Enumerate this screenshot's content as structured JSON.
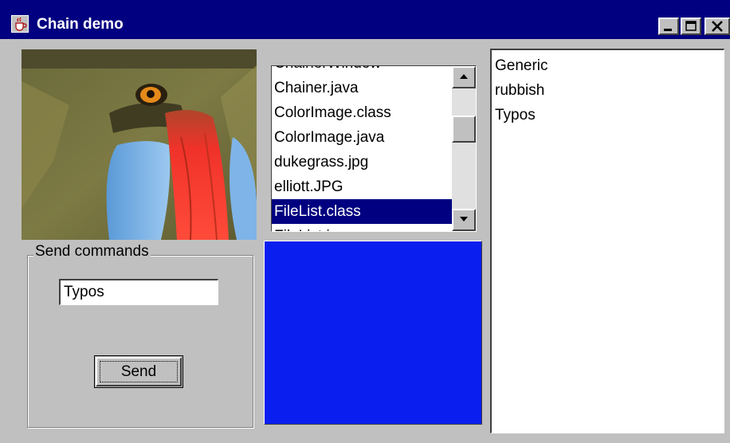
{
  "window": {
    "title": "Chain demo",
    "icon": "java-cup-icon",
    "buttons": [
      "minimize",
      "maximize",
      "close"
    ]
  },
  "image_panel": {
    "content": "mandrill-face-image"
  },
  "file_list": {
    "items": [
      "ChainerWindow",
      "Chainer.java",
      "ColorImage.class",
      "ColorImage.java",
      "dukegrass.jpg",
      "elliott.JPG",
      "FileList.class",
      "FileList.java"
    ],
    "selected": "FileList.class"
  },
  "text_area": {
    "lines": [
      "Generic",
      "rubbish",
      "Typos"
    ]
  },
  "send_commands": {
    "title": "Send commands",
    "input_value": "Typos",
    "send_label": "Send"
  },
  "colors": {
    "titlebar": "#000080",
    "window_bg": "#c0c0c0",
    "selection": "#000080",
    "color_panel": "#0a1ef0"
  }
}
